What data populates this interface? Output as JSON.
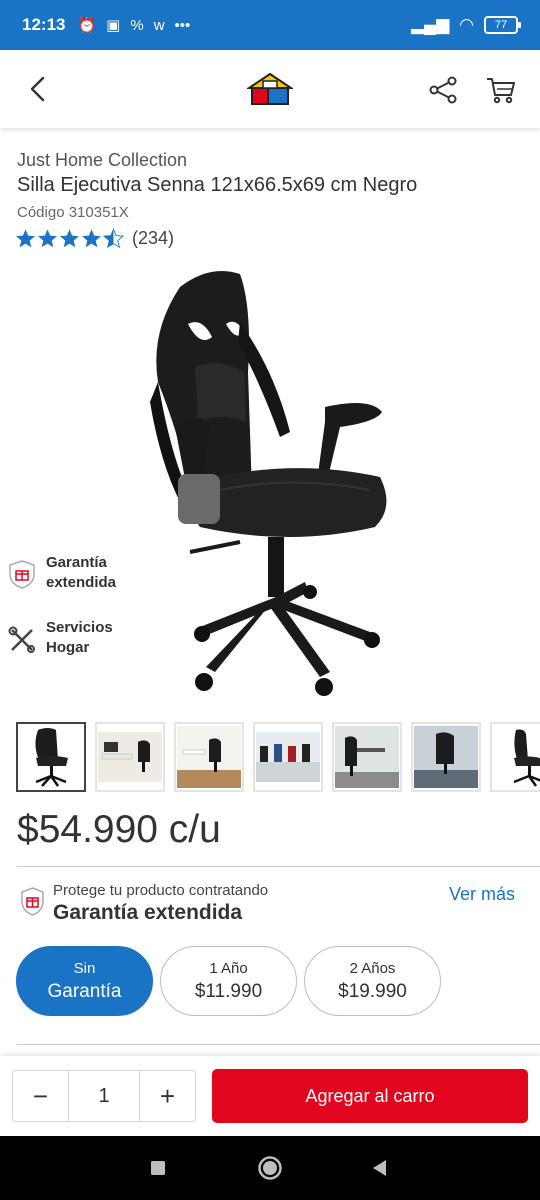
{
  "status_bar": {
    "time": "12:13",
    "battery": "77"
  },
  "product": {
    "brand": "Just Home Collection",
    "title": "Silla Ejecutiva Senna 121x66.5x69 cm Negro",
    "code": "Código 310351X",
    "rating": 4.5,
    "review_count": "(234)",
    "price": "$54.990 c/u"
  },
  "side_links": [
    {
      "line1": "Garantía",
      "line2": "extendida",
      "icon": "shield-gift-icon"
    },
    {
      "line1": "Servicios",
      "line2": "Hogar",
      "icon": "tools-icon"
    }
  ],
  "thumbnails_count_visible": 7,
  "warranty": {
    "protect_text": "Protege tu producto contratando",
    "title": "Garantía extendida",
    "see_more": "Ver más",
    "options": [
      {
        "line1": "Sin",
        "line2": "Garantía",
        "selected": true
      },
      {
        "line1": "1 Año",
        "line2": "$11.990",
        "selected": false
      },
      {
        "line1": "2 Años",
        "line2": "$19.990",
        "selected": false
      }
    ]
  },
  "cart": {
    "quantity": "1",
    "minus": "−",
    "plus": "+",
    "add_label": "Agregar al carro"
  },
  "colors": {
    "brand_blue": "#1a73c4",
    "cta_red": "#e1051d",
    "star_blue": "#1a73c4"
  }
}
